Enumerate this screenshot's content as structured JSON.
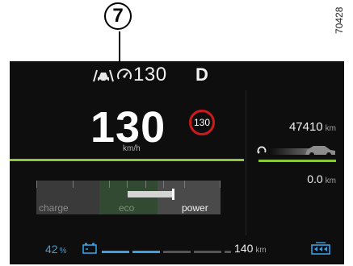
{
  "annotation": {
    "callout_number": "7",
    "reference_code": "70428"
  },
  "top_bar": {
    "set_speed": "130",
    "gear": "D",
    "icons": [
      "car-assist-icon",
      "speed-limiter-icon"
    ]
  },
  "speedometer": {
    "speed": "130",
    "unit": "km/h",
    "speed_limit": "130"
  },
  "right_panel": {
    "odometer": {
      "value": "47410",
      "unit": "km"
    },
    "trip": {
      "value": "0.0",
      "unit": "km"
    },
    "icons": [
      "reset-icon",
      "car-silhouette-icon"
    ]
  },
  "power_gauge": {
    "labels": {
      "charge": "charge",
      "eco": "eco",
      "power": "power"
    },
    "active_label": "power"
  },
  "bottom_bar": {
    "battery": {
      "value": "42",
      "unit": "%"
    },
    "range": {
      "value": "140",
      "unit": "km"
    },
    "icons": [
      "battery-icon",
      "charge-mode-icon"
    ]
  },
  "colors": {
    "accent_green": "#8ec63f",
    "battery_blue": "#3aa0e0",
    "limit_red": "#cc1a1a",
    "screen_bg": "#0e0e0e"
  }
}
